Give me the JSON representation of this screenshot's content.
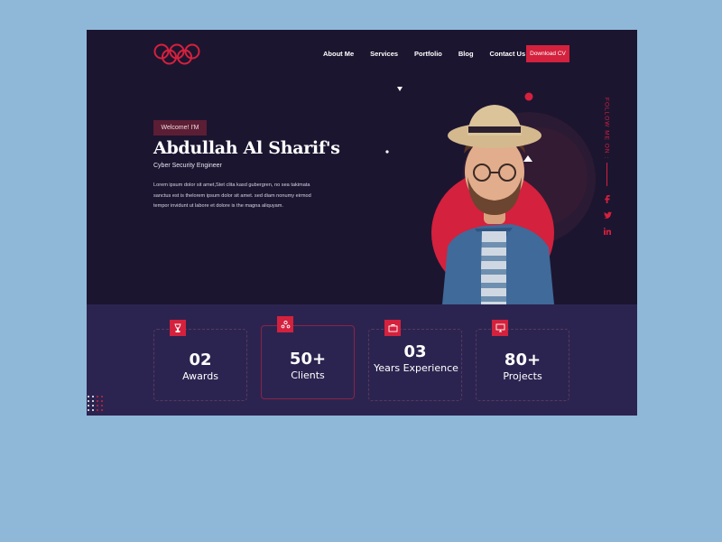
{
  "nav": {
    "items": [
      "About Me",
      "Services",
      "Portfolio",
      "Blog",
      "Contact Us"
    ],
    "cta_label": "Download CV"
  },
  "hero": {
    "badge": "Welcome! I'M",
    "name": "Abdullah Al Sharif's",
    "role": "Cyber Security Engineer",
    "bio": "Lorem ipsum dolor sit amet,Stet clita kasd gubergren, no sea takimata sanctus est is thelorem ipsum dolor sit amet. sed diam nonumy eirmod tempor invidunt ut labore et dolore is the magna aliquyam."
  },
  "social": {
    "label": "FOLLOW ME ON :",
    "icons": [
      "facebook-icon",
      "twitter-icon",
      "linkedin-icon"
    ]
  },
  "stats": [
    {
      "number": "02",
      "label": "Awards",
      "icon": "trophy-icon"
    },
    {
      "number": "50+",
      "label": "Clients",
      "icon": "users-icon"
    },
    {
      "number": "03",
      "label": "Years Experience",
      "icon": "briefcase-icon"
    },
    {
      "number": "80+",
      "label": "Projects",
      "icon": "monitor-icon"
    }
  ],
  "colors": {
    "accent": "#d4213d",
    "background": "#1c1530",
    "stats_background": "#2c2450",
    "page_background": "#8fb8d8"
  }
}
